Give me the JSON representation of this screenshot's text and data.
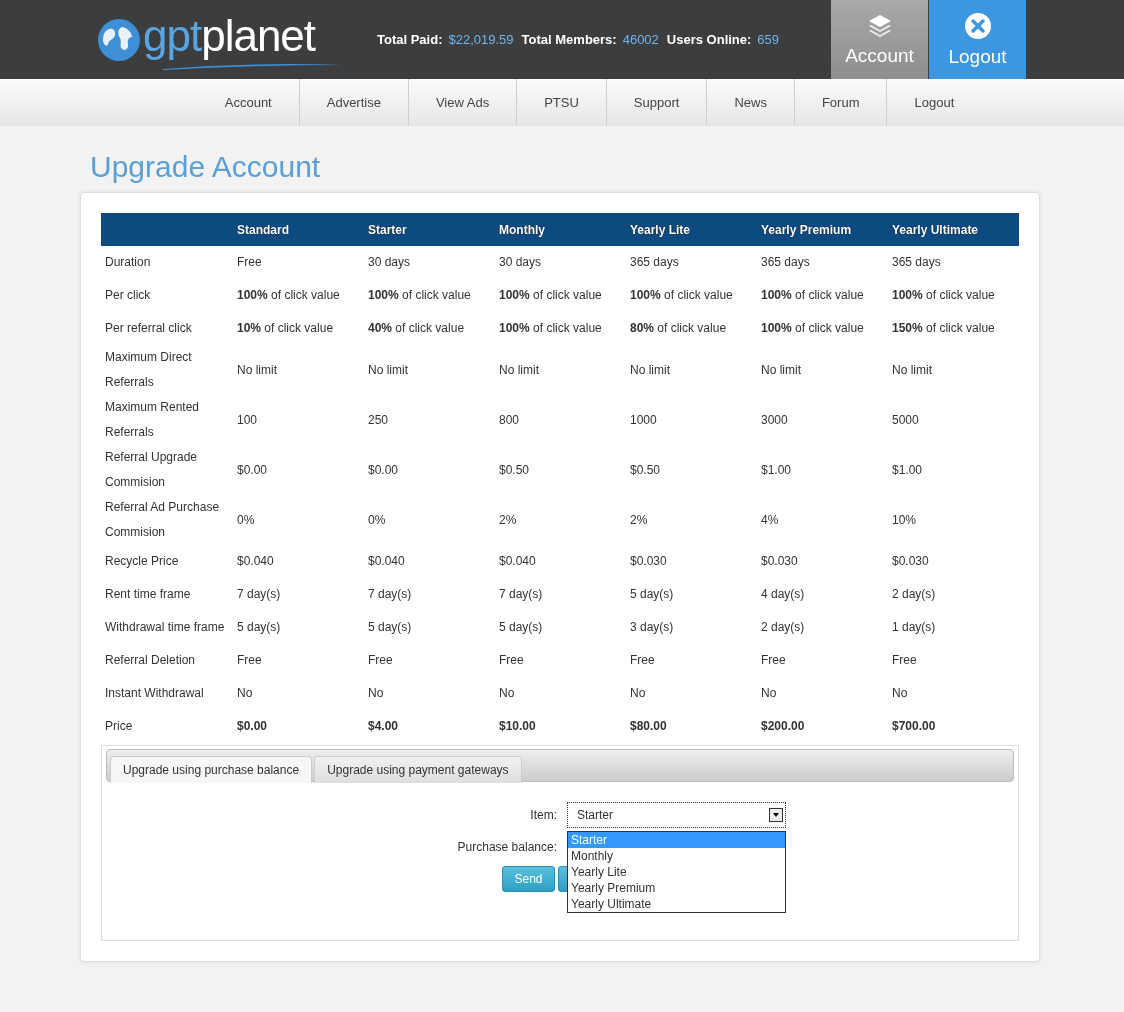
{
  "header": {
    "logo": {
      "part_1": "gpt",
      "part_2": "planet"
    },
    "stats": [
      {
        "label": "Total Paid:",
        "value": "$22,019.59"
      },
      {
        "label": "Total Members:",
        "value": "46002"
      },
      {
        "label": "Users Online:",
        "value": "659"
      }
    ],
    "tiles": [
      {
        "label": "Account",
        "kind": "layers",
        "selected": false
      },
      {
        "label": "Logout",
        "kind": "close",
        "selected": true
      }
    ]
  },
  "nav": [
    "Account",
    "Advertise",
    "View Ads",
    "PTSU",
    "Support",
    "News",
    "Forum",
    "Logout"
  ],
  "page_title": "Upgrade Account",
  "table": {
    "columns": [
      "",
      "Standard",
      "Starter",
      "Monthly",
      "Yearly Lite",
      "Yearly Premium",
      "Yearly Ultimate"
    ],
    "rows": [
      {
        "kind": "plain",
        "cells": [
          "Duration",
          "Free",
          "30 days",
          "30 days",
          "365 days",
          "365 days",
          "365 days"
        ]
      },
      {
        "kind": "plain",
        "cells": [
          "Per click",
          "**100%** of click value",
          "**100%** of click value",
          "**100%** of click value",
          "**100%** of click value",
          "**100%** of click value",
          "**100%** of click value"
        ]
      },
      {
        "kind": "plain",
        "cells": [
          "Per referral click",
          "**10%** of click value",
          "**40%** of click value",
          "**100%** of click value",
          "**80%** of click value",
          "**100%** of click value",
          "**150%** of click value"
        ]
      },
      {
        "kind": "plain",
        "cells": [
          "Maximum Direct Referrals",
          "No limit",
          "No limit",
          "No limit",
          "No limit",
          "No limit",
          "No limit"
        ]
      },
      {
        "kind": "plain",
        "cells": [
          "Maximum Rented Referrals",
          "100",
          "250",
          "800",
          "1000",
          "3000",
          "5000"
        ]
      },
      {
        "kind": "plain",
        "cells": [
          "Referral Upgrade Commision",
          "$0.00",
          "$0.00",
          "$0.50",
          "$0.50",
          "$1.00",
          "$1.00"
        ]
      },
      {
        "kind": "plain",
        "cells": [
          "Referral Ad Purchase Commision",
          "0%",
          "0%",
          "2%",
          "2%",
          "4%",
          "10%"
        ]
      },
      {
        "kind": "plain",
        "cells": [
          "Recycle Price",
          "$0.040",
          "$0.040",
          "$0.040",
          "$0.030",
          "$0.030",
          "$0.030"
        ]
      },
      {
        "kind": "plain",
        "cells": [
          "Rent time frame",
          "7 day(s)",
          "7 day(s)",
          "7 day(s)",
          "5 day(s)",
          "4 day(s)",
          "2 day(s)"
        ]
      },
      {
        "kind": "plain",
        "cells": [
          "Withdrawal time frame",
          "5 day(s)",
          "5 day(s)",
          "5 day(s)",
          "3 day(s)",
          "2 day(s)",
          "1 day(s)"
        ]
      },
      {
        "kind": "plain",
        "cells": [
          "Referral Deletion",
          "Free",
          "Free",
          "Free",
          "Free",
          "Free",
          "Free"
        ]
      },
      {
        "kind": "plain",
        "cells": [
          "Instant Withdrawal",
          "No",
          "No",
          "No",
          "No",
          "No",
          "No"
        ]
      },
      {
        "kind": "total",
        "cells": [
          "Price",
          "$0.00",
          "$4.00",
          "$10.00",
          "$80.00",
          "$200.00",
          "$700.00"
        ]
      }
    ]
  },
  "upgrade": {
    "tabs": [
      {
        "label": "Upgrade using purchase balance",
        "selected": true
      },
      {
        "label": "Upgrade using payment gateways",
        "selected": false
      }
    ],
    "item_label": "Item:",
    "item_value": "Starter",
    "options": [
      {
        "label": "Starter",
        "selected": true
      },
      {
        "label": "Monthly",
        "selected": false
      },
      {
        "label": "Yearly Lite",
        "selected": false
      },
      {
        "label": "Yearly Premium",
        "selected": false
      },
      {
        "label": "Yearly Ultimate",
        "selected": false
      }
    ],
    "balance_label": "Purchase balance:",
    "send": "Send"
  }
}
